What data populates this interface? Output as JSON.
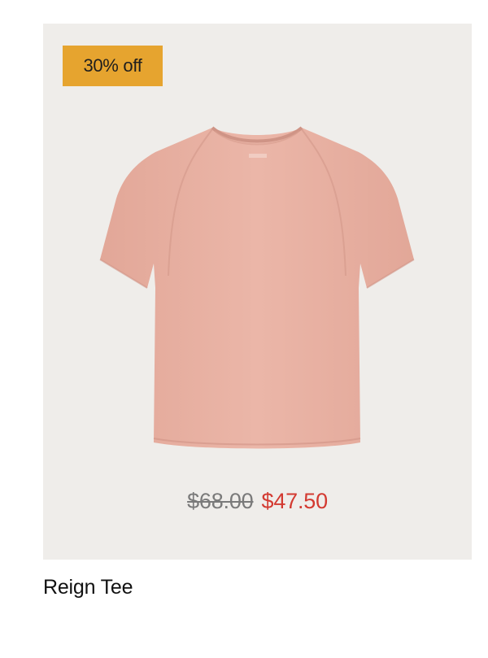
{
  "badge": {
    "label": "30% off",
    "color": "#e6a42f"
  },
  "product": {
    "name": "Reign Tee",
    "image_alt": "pink t-shirt",
    "shirt_color": "#e8b0a2"
  },
  "pricing": {
    "original_price": "$68.00",
    "sale_price": "$47.50",
    "sale_color": "#d33a31"
  },
  "card": {
    "background": "#efedea"
  }
}
